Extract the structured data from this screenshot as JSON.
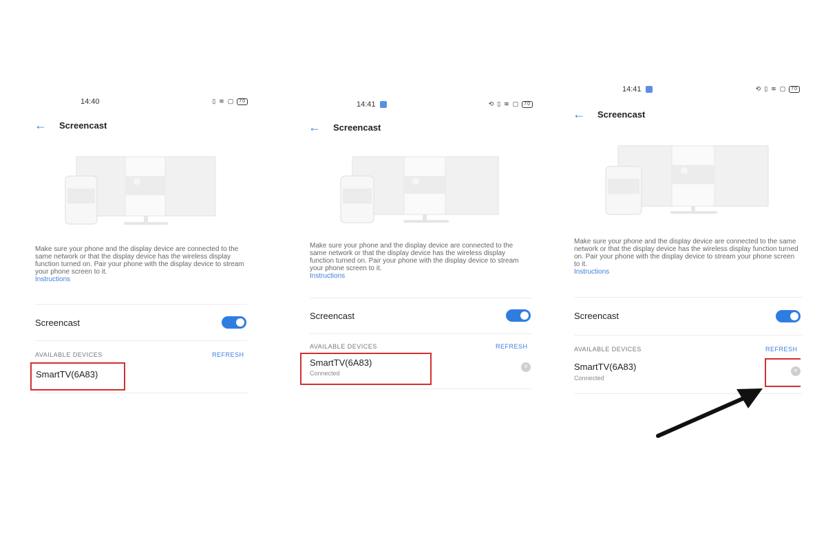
{
  "screens": [
    {
      "time": "14:40",
      "battery": "70",
      "header_title": "Screencast",
      "description": "Make sure your phone and the display device are connected to the same network or that the display device has the wireless display function turned on. Pair your phone with the display device to stream your phone screen to it.",
      "instructions_link": "Instructions",
      "toggle_label": "Screencast",
      "section_title": "AVAILABLE DEVICES",
      "refresh_label": "REFRESH",
      "device_name": "SmartTV(6A83)",
      "device_status": ""
    },
    {
      "time": "14:41",
      "battery": "70",
      "header_title": "Screencast",
      "description": "Make sure your phone and the display device are connected to the same network or that the display device has the wireless display function turned on. Pair your phone with the display device to stream your phone screen to it.",
      "instructions_link": "Instructions",
      "toggle_label": "Screencast",
      "section_title": "AVAILABLE DEVICES",
      "refresh_label": "REFRESH",
      "device_name": "SmartTV(6A83)",
      "device_status": "Connected"
    },
    {
      "time": "14:41",
      "battery": "70",
      "header_title": "Screencast",
      "description": "Make sure your phone and the display device are connected to the same network or that the display device has the wireless display function turned on. Pair your phone with the display device to stream your phone screen to it.",
      "instructions_link": "Instructions",
      "toggle_label": "Screencast",
      "section_title": "AVAILABLE DEVICES",
      "refresh_label": "REFRESH",
      "device_name": "SmartTV(6A83)",
      "device_status": "Connected"
    }
  ],
  "colors": {
    "accent": "#2f7de1",
    "highlight": "#d32f2f",
    "arrow": "#111111"
  },
  "icons": [
    "back-arrow-icon",
    "vibrate-icon",
    "wifi-icon",
    "battery-icon",
    "disconnect-icon",
    "pointer-arrow-icon"
  ]
}
